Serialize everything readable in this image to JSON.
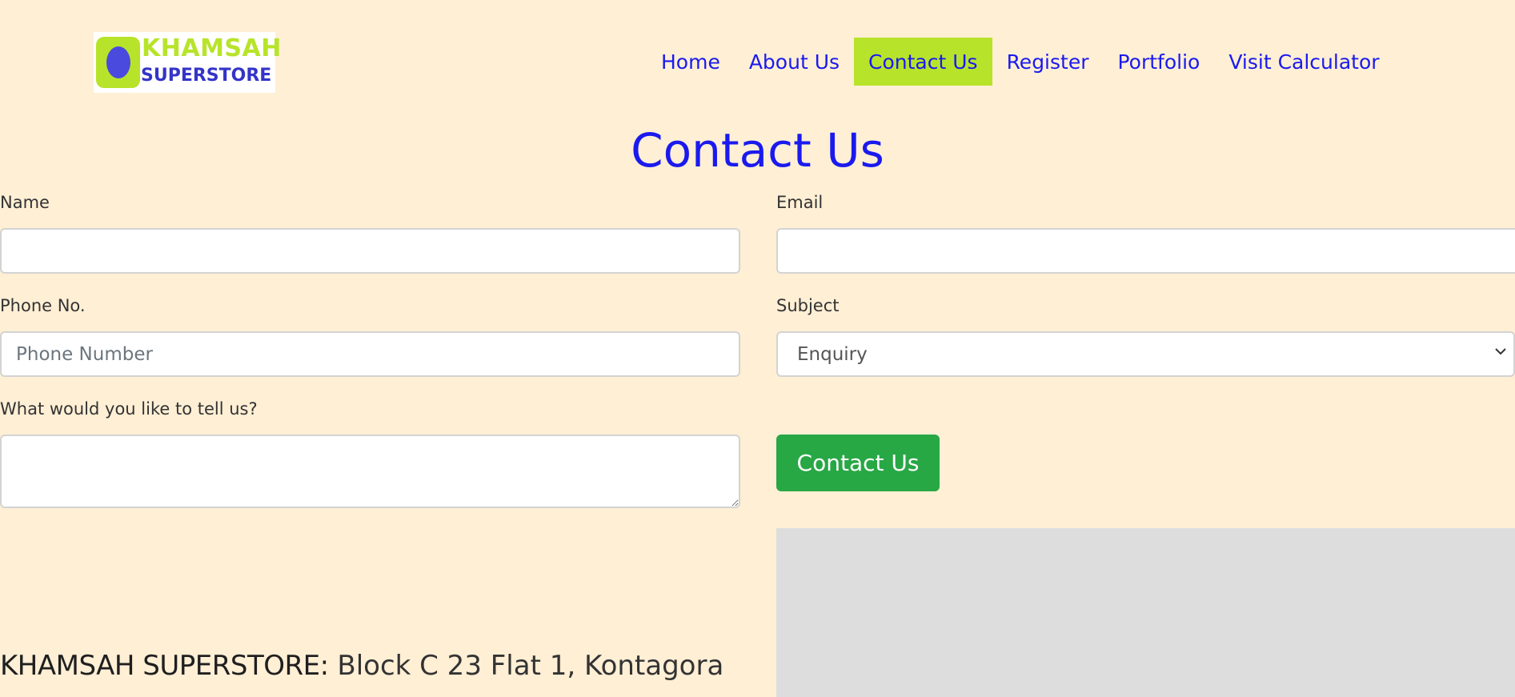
{
  "brand": {
    "line1": "KHAMSAH",
    "line2": "SUPERSTORE",
    "colors": {
      "green": "#b7e42a",
      "blue": "#3434c8"
    }
  },
  "nav": {
    "items": [
      {
        "label": "Home",
        "active": false
      },
      {
        "label": "About Us",
        "active": false
      },
      {
        "label": "Contact Us",
        "active": true
      },
      {
        "label": "Register",
        "active": false
      },
      {
        "label": "Portfolio",
        "active": false
      },
      {
        "label": "Visit Calculator",
        "active": false
      }
    ],
    "active_bg": "#b7e42a",
    "link_color": "#1a1aee"
  },
  "page": {
    "title": "Contact Us",
    "background": "#ffefd5"
  },
  "form": {
    "name": {
      "label": "Name",
      "value": "",
      "placeholder": ""
    },
    "email": {
      "label": "Email",
      "value": "",
      "placeholder": ""
    },
    "phone": {
      "label": "Phone No.",
      "value": "",
      "placeholder": "Phone Number"
    },
    "subject": {
      "label": "Subject",
      "selected": "Enquiry"
    },
    "message": {
      "label": "What would you like to tell us?",
      "value": ""
    },
    "submit_label": "Contact Us",
    "submit_color": "#28a745"
  },
  "address": {
    "name": "KHAMSAH SUPERSTORE:",
    "text": " Block C 23 Flat 1, Kontagora"
  }
}
